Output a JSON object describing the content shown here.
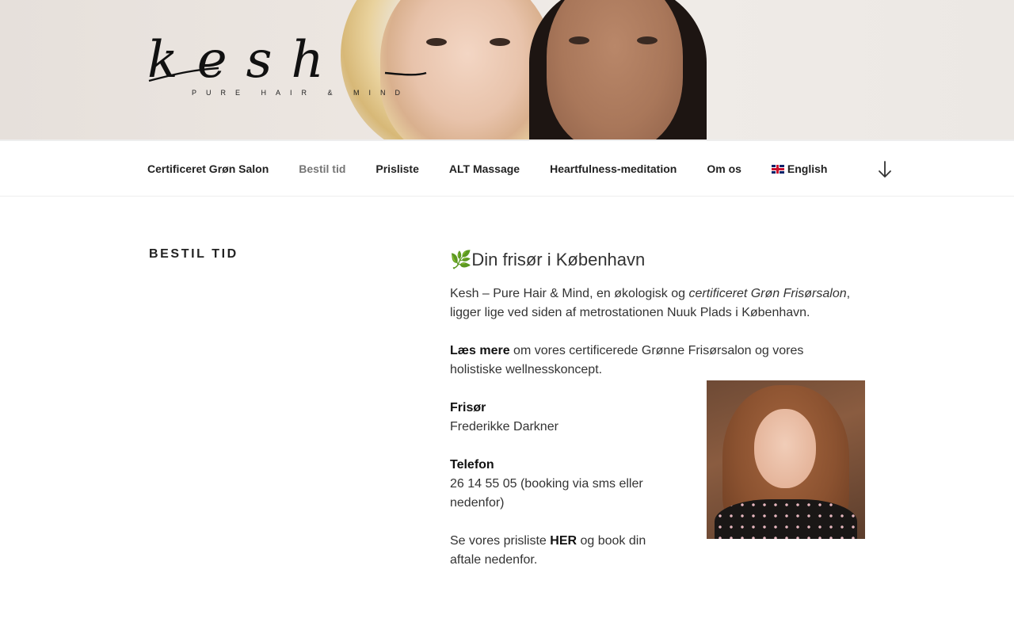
{
  "header": {
    "logo_word": "kesh",
    "logo_tagline": "PURE HAIR & MIND"
  },
  "nav": {
    "items": [
      {
        "label": "Certificeret Grøn Salon",
        "active": false
      },
      {
        "label": "Bestil tid",
        "active": true
      },
      {
        "label": "Prisliste",
        "active": false
      },
      {
        "label": "ALT Massage",
        "active": false
      },
      {
        "label": "Heartfulness-meditation",
        "active": false
      },
      {
        "label": "Om os",
        "active": false
      },
      {
        "label": "English",
        "active": false
      }
    ],
    "scroll_icon": "arrow-down-icon"
  },
  "page": {
    "title": "Bestil tid",
    "heading_emoji": "🌿",
    "heading": "Din frisør i København",
    "p1_a": "Kesh – Pure Hair & Mind, en økologisk og ",
    "p1_em": "certificeret Grøn Frisørsalon",
    "p1_b": ", ligger lige ved siden af metrostationen Nuuk Plads i København.",
    "p2_strong": "Læs mere",
    "p2_rest": " om vores certificerede Grønne Frisørsalon og vores holistiske wellnesskoncept.",
    "p3_label": "Frisør",
    "p3_value": "Frederikke Darkner",
    "p4_label": "Telefon",
    "p4_value": "26 14 55 05 (booking via sms eller nedenfor)",
    "p5_a": "Se vores prisliste ",
    "p5_link": "HER",
    "p5_b": " og book din aftale nedenfor."
  }
}
